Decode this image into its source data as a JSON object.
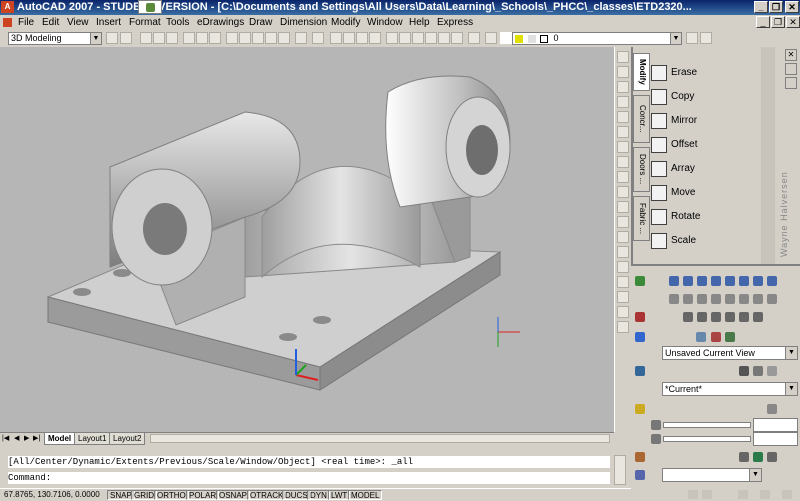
{
  "window": {
    "title": "AutoCAD 2007 - STUDENT VERSION - [C:\\Documents and Settings\\All Users\\Data\\Learning\\_Schools\\_PHCC\\_classes\\ETD2320...",
    "minimize": "_",
    "restore": "❐",
    "close": "✕"
  },
  "menu": [
    "File",
    "Edit",
    "View",
    "Insert",
    "Format",
    "Tools",
    "eDrawings",
    "Draw",
    "Dimension",
    "Modify",
    "Window",
    "Help",
    "Express"
  ],
  "toolbar": {
    "workspace": "3D Modeling",
    "layer": "0"
  },
  "tool_palette": {
    "tabs": [
      "Modify",
      "Concr...",
      "Doors ...",
      "Fabric ..."
    ],
    "tools": [
      "Erase",
      "Copy",
      "Mirror",
      "Offset",
      "Array",
      "Move",
      "Rotate",
      "Scale"
    ],
    "side_label": "Wayne Halversen"
  },
  "dashboard": {
    "view_combo": "Unsaved Current View",
    "visual_style_combo": "*Current*"
  },
  "layout_tabs": [
    "Model",
    "Layout1",
    "Layout2"
  ],
  "command": {
    "history": "[All/Center/Dynamic/Extents/Previous/Scale/Window/Object] <real time>: _all",
    "prompt": "Command:"
  },
  "status": {
    "coords": "67.8765, 130.7106, 0.0000",
    "toggles": [
      "SNAP",
      "GRID",
      "ORTHO",
      "POLAR",
      "OSNAP",
      "OTRACK",
      "DUCS",
      "DYN",
      "LWT",
      "MODEL"
    ]
  },
  "colors": {
    "title_gradient_start": "#0a246a",
    "viewport_bg": "#b6b6b6",
    "ucs_x": "#e02020",
    "ucs_y": "#20a020",
    "ucs_z": "#2060e0"
  }
}
